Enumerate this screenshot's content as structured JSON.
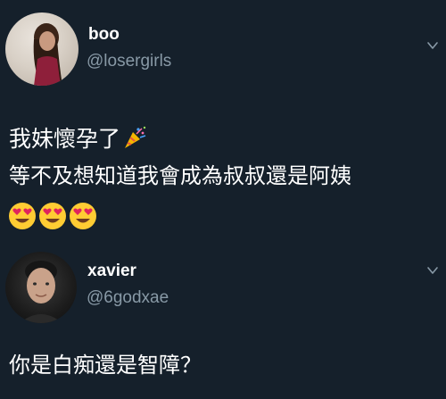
{
  "tweets": [
    {
      "display_name": "boo",
      "handle": "@losergirls",
      "text_lines": [
        "我妹懷孕了",
        "等不及想知道我會成為叔叔還是阿姨"
      ],
      "emojis": [
        "heart-eyes-emoji",
        "heart-eyes-emoji",
        "heart-eyes-emoji"
      ],
      "inline_emoji": "party-popper-icon"
    },
    {
      "display_name": "xavier",
      "handle": "@6godxae",
      "text": "你是白痴還是智障？"
    }
  ],
  "colors": {
    "background": "#15202b",
    "text": "#ffffff",
    "handle": "#8899a6"
  }
}
